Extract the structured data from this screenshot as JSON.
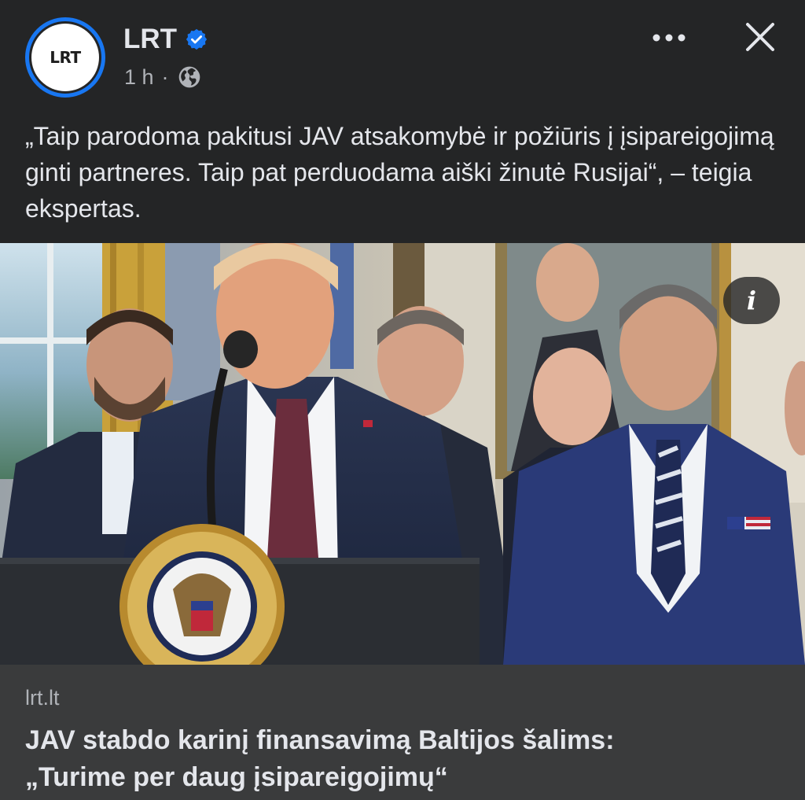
{
  "post": {
    "page_name": "LRT",
    "avatar_text": "LRT",
    "time": "1 h",
    "separator": "·",
    "privacy_icon": "globe-icon",
    "verified_icon": "verified-badge-icon",
    "text": "„Taip parodoma pakitusi JAV atsakomybė ir požiūris į įsipareigojimą ginti partneres. Taip pat perduodama aiški žinutė Rusijai“, – teigia ekspertas."
  },
  "actions": {
    "more_icon": "more-horizontal-icon",
    "close_icon": "close-icon"
  },
  "image": {
    "info_glyph": "i"
  },
  "link_preview": {
    "domain": "lrt.lt",
    "title_line1": "JAV stabdo karinį finansavimą Baltijos šalims:",
    "title_line2": "„Turime per daug įsipareigojimų“"
  },
  "colors": {
    "background": "#242526",
    "link_preview_bg": "#3a3b3c",
    "accent_blue": "#1877f2",
    "primary_text": "#e4e6eb",
    "secondary_text": "#b0b3b8"
  }
}
